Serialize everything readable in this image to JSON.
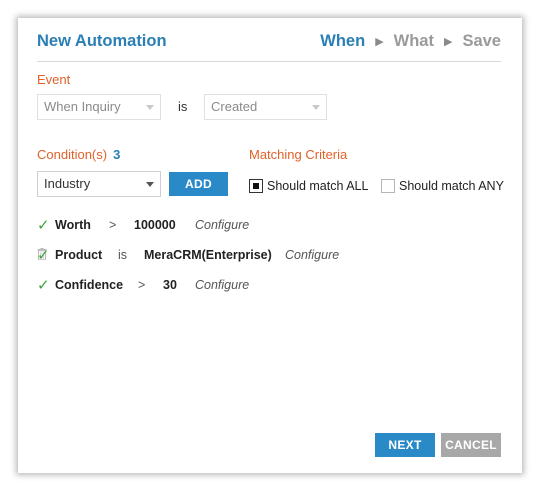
{
  "header": {
    "title": "New Automation",
    "steps": [
      "When",
      "What",
      "Save"
    ],
    "active_step": "When"
  },
  "event": {
    "label": "Event",
    "trigger_select": "When Inquiry",
    "is_text": "is",
    "state_select": "Created"
  },
  "conditions": {
    "label": "Condition(s)",
    "count": "3",
    "field_select": "Industry",
    "add_label": "ADD",
    "rows": [
      {
        "field": "Worth",
        "operator": ">",
        "value": "100000",
        "configure": "Configure",
        "show_delete": false
      },
      {
        "field": "Product",
        "operator": "is",
        "value": "MeraCRM(Enterprise)",
        "configure": "Configure",
        "show_delete": true
      },
      {
        "field": "Confidence",
        "operator": ">",
        "value": "30",
        "configure": "Configure",
        "show_delete": false
      }
    ]
  },
  "matching": {
    "label": "Matching Criteria",
    "all_label": "Should match ALL",
    "any_label": "Should match ANY",
    "all_checked": true,
    "any_checked": false
  },
  "footer": {
    "next_label": "NEXT",
    "cancel_label": "CANCEL"
  },
  "colors": {
    "accent_blue": "#2a7fb4",
    "label_orange": "#e0622a",
    "tick_green": "#3fa33a",
    "button_gray": "#a8a8a8"
  }
}
